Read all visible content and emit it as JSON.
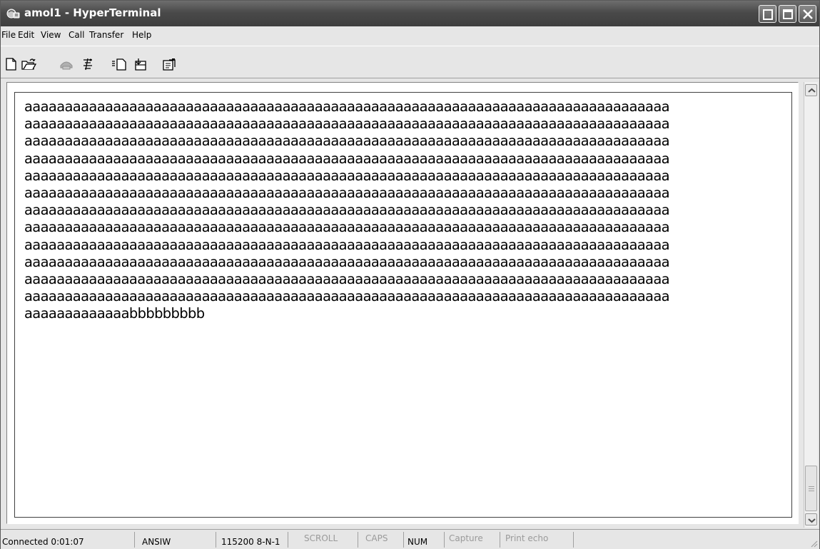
{
  "window": {
    "title": "amol1 - HyperTerminal"
  },
  "menu": [
    "File",
    "Edit",
    "View",
    "Call",
    "Transfer",
    "Help"
  ],
  "toolbar": {
    "icons": [
      "new-document-icon",
      "open-folder-icon",
      "phone-call-icon",
      "disconnect-icon",
      "send-icon",
      "receive-icon",
      "properties-icon"
    ]
  },
  "terminal": {
    "lines": [
      "aaaaaaaaaaaaaaaaaaaaaaaaaaaaaaaaaaaaaaaaaaaaaaaaaaaaaaaaaaaaaaaaaaaaaaaaaaaaaaaa",
      "aaaaaaaaaaaaaaaaaaaaaaaaaaaaaaaaaaaaaaaaaaaaaaaaaaaaaaaaaaaaaaaaaaaaaaaaaaaaaaaa",
      "aaaaaaaaaaaaaaaaaaaaaaaaaaaaaaaaaaaaaaaaaaaaaaaaaaaaaaaaaaaaaaaaaaaaaaaaaaaaaaaa",
      "aaaaaaaaaaaaaaaaaaaaaaaaaaaaaaaaaaaaaaaaaaaaaaaaaaaaaaaaaaaaaaaaaaaaaaaaaaaaaaaa",
      "aaaaaaaaaaaaaaaaaaaaaaaaaaaaaaaaaaaaaaaaaaaaaaaaaaaaaaaaaaaaaaaaaaaaaaaaaaaaaaaa",
      "aaaaaaaaaaaaaaaaaaaaaaaaaaaaaaaaaaaaaaaaaaaaaaaaaaaaaaaaaaaaaaaaaaaaaaaaaaaaaaaa",
      "aaaaaaaaaaaaaaaaaaaaaaaaaaaaaaaaaaaaaaaaaaaaaaaaaaaaaaaaaaaaaaaaaaaaaaaaaaaaaaaa",
      "aaaaaaaaaaaaaaaaaaaaaaaaaaaaaaaaaaaaaaaaaaaaaaaaaaaaaaaaaaaaaaaaaaaaaaaaaaaaaaaa",
      "aaaaaaaaaaaaaaaaaaaaaaaaaaaaaaaaaaaaaaaaaaaaaaaaaaaaaaaaaaaaaaaaaaaaaaaaaaaaaaaa",
      "aaaaaaaaaaaaaaaaaaaaaaaaaaaaaaaaaaaaaaaaaaaaaaaaaaaaaaaaaaaaaaaaaaaaaaaaaaaaaaaa",
      "aaaaaaaaaaaaaaaaaaaaaaaaaaaaaaaaaaaaaaaaaaaaaaaaaaaaaaaaaaaaaaaaaaaaaaaaaaaaaaaa",
      "aaaaaaaaaaaaaaaaaaaaaaaaaaaaaaaaaaaaaaaaaaaaaaaaaaaaaaaaaaaaaaaaaaaaaaaaaaaaaaaa",
      "aaaaaaaaaaaaabbbbbbbbb"
    ]
  },
  "status": {
    "connected": "Connected 0:01:07",
    "emulation": "ANSIW",
    "port_settings": "115200 8-N-1",
    "scroll": "SCROLL",
    "caps": "CAPS",
    "num": "NUM",
    "capture": "Capture",
    "print_echo": "Print echo"
  },
  "colors": {
    "titlebar": "#4a4a4a",
    "chrome": "#e6e6e6",
    "terminal_bg": "#ffffff",
    "dim_text": "#9a9a9a"
  }
}
